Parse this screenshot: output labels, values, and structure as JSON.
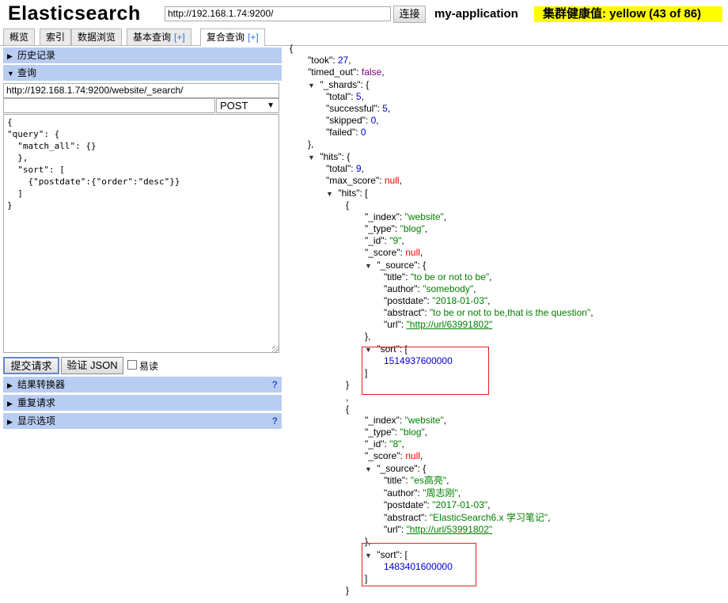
{
  "header": {
    "logo": "Elasticsearch",
    "url": "http://192.168.1.74:9200/",
    "connect_label": "连接",
    "cluster_name": "my-application",
    "health": "集群健康值: yellow (43 of 86)"
  },
  "tabs": [
    {
      "label": "概览"
    },
    {
      "label": "索引"
    },
    {
      "label": "数据浏览"
    },
    {
      "label": "基本查询",
      "plus": "[+]"
    },
    {
      "label": "复合查询",
      "plus": "[+]",
      "active": true
    }
  ],
  "left": {
    "history_label": "历史记录",
    "query_label": "查询",
    "path": "http://192.168.1.74:9200/website/_search/",
    "method": "POST",
    "body": "{\n\"query\": {\n  \"match_all\": {}\n  },\n  \"sort\": [\n    {\"postdate\":{\"order\":\"desc\"}}\n  ]\n}",
    "submit_label": "提交请求",
    "validate_label": "验证 JSON",
    "readonly_label": "易读",
    "result_transformer_label": "结果转换器",
    "repeat_label": "重复请求",
    "display_options_label": "显示选项",
    "help_mark": "?"
  },
  "result": {
    "took": "27",
    "timed_out": "false",
    "shards": {
      "total": "5",
      "successful": "5",
      "skipped": "0",
      "failed": "0"
    },
    "hits_total": "9",
    "max_score": "null",
    "hits": [
      {
        "index": "website",
        "type": "blog",
        "id": "9",
        "score": "null",
        "title": "to be or not to be",
        "author": "somebody",
        "postdate": "2018-01-03",
        "abstract": "to be or not to be,that is the question",
        "url": "http://url/63991802",
        "sort": "1514937600000"
      },
      {
        "index": "website",
        "type": "blog",
        "id": "8",
        "score": "null",
        "title": "es高亮",
        "author": "周志刚",
        "postdate": "2017-01-03",
        "abstract": "ElasticSearch6.x 学习笔记",
        "url": "http://url/53991802",
        "sort": "1483401600000"
      }
    ]
  }
}
